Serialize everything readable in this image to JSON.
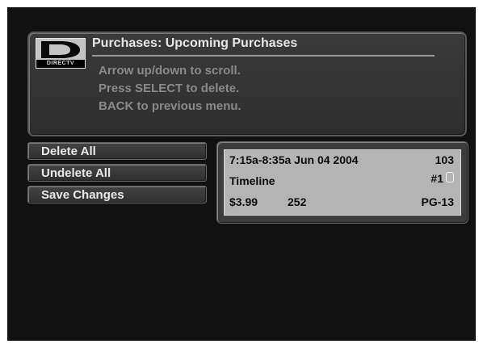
{
  "header": {
    "logo_text": "DIRECTV",
    "title": "Purchases: Upcoming Purchases",
    "instructions": [
      "Arrow up/down to scroll.",
      "Press SELECT to delete.",
      "BACK to previous menu."
    ]
  },
  "menu": {
    "items": [
      {
        "label": "Delete All"
      },
      {
        "label": "Undelete All"
      },
      {
        "label": "Save Changes"
      }
    ]
  },
  "purchase": {
    "time_date": "7:15a-8:35a Jun  04 2004",
    "channel": "103",
    "title": "Timeline",
    "rank": "#1",
    "lock_icon": "lock-icon",
    "price": "$3.99",
    "code": "252",
    "rating": "PG-13"
  },
  "colors": {
    "background": "#111111",
    "panel": "#333333",
    "detail_bg": "#b4b4b4"
  }
}
